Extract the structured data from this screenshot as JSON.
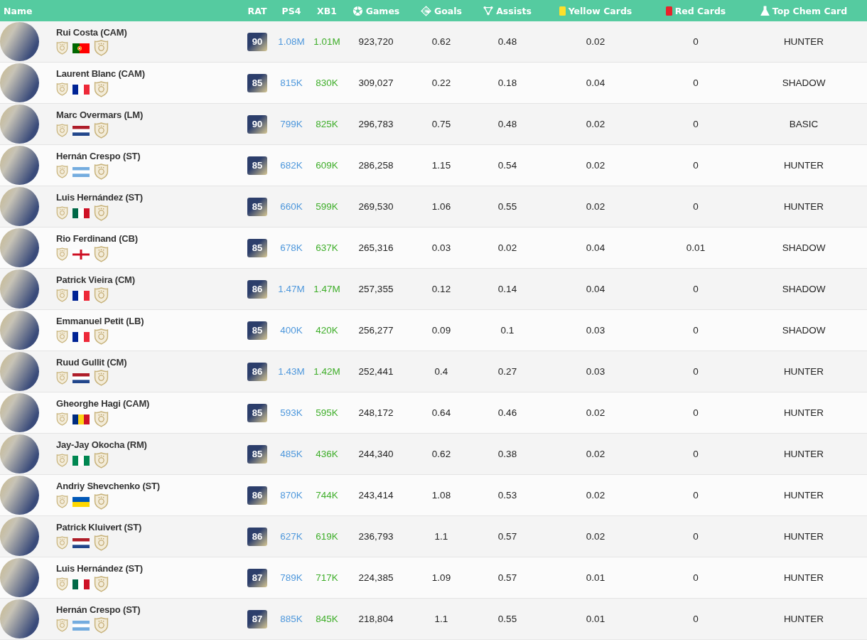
{
  "columns": [
    {
      "label": "Name"
    },
    {
      "label": "RAT"
    },
    {
      "label": "PS4"
    },
    {
      "label": "XB1"
    },
    {
      "label": "Games"
    },
    {
      "label": "Goals"
    },
    {
      "label": "Assists"
    },
    {
      "label": "Yellow Cards"
    },
    {
      "label": "Red Cards"
    },
    {
      "label": "Top Chem Card"
    }
  ],
  "rows": [
    {
      "name": "Rui Costa (CAM)",
      "kind": "portugal",
      "rating": "90",
      "ps4": "1.08M",
      "xb1": "1.01M",
      "games": "923,720",
      "goals": "0.62",
      "assists": "0.48",
      "yellow": "0.02",
      "red": "0",
      "chem": "HUNTER"
    },
    {
      "name": "Laurent Blanc (CAM)",
      "kind": "france",
      "rating": "85",
      "ps4": "815K",
      "xb1": "830K",
      "games": "309,027",
      "goals": "0.22",
      "assists": "0.18",
      "yellow": "0.04",
      "red": "0",
      "chem": "SHADOW"
    },
    {
      "name": "Marc Overmars (LM)",
      "kind": "netherlands",
      "rating": "90",
      "ps4": "799K",
      "xb1": "825K",
      "games": "296,783",
      "goals": "0.75",
      "assists": "0.48",
      "yellow": "0.02",
      "red": "0",
      "chem": "BASIC"
    },
    {
      "name": "Hernán Crespo (ST)",
      "kind": "argentina",
      "rating": "85",
      "ps4": "682K",
      "xb1": "609K",
      "games": "286,258",
      "goals": "1.15",
      "assists": "0.54",
      "yellow": "0.02",
      "red": "0",
      "chem": "HUNTER"
    },
    {
      "name": "Luis Hernández (ST)",
      "kind": "mexico",
      "rating": "85",
      "ps4": "660K",
      "xb1": "599K",
      "games": "269,530",
      "goals": "1.06",
      "assists": "0.55",
      "yellow": "0.02",
      "red": "0",
      "chem": "HUNTER"
    },
    {
      "name": "Rio Ferdinand (CB)",
      "kind": "england",
      "rating": "85",
      "ps4": "678K",
      "xb1": "637K",
      "games": "265,316",
      "goals": "0.03",
      "assists": "0.02",
      "yellow": "0.04",
      "red": "0.01",
      "chem": "SHADOW"
    },
    {
      "name": "Patrick Vieira (CM)",
      "kind": "france",
      "rating": "86",
      "ps4": "1.47M",
      "xb1": "1.47M",
      "games": "257,355",
      "goals": "0.12",
      "assists": "0.14",
      "yellow": "0.04",
      "red": "0",
      "chem": "SHADOW"
    },
    {
      "name": "Emmanuel Petit (LB)",
      "kind": "france",
      "rating": "85",
      "ps4": "400K",
      "xb1": "420K",
      "games": "256,277",
      "goals": "0.09",
      "assists": "0.1",
      "yellow": "0.03",
      "red": "0",
      "chem": "SHADOW"
    },
    {
      "name": "Ruud Gullit (CM)",
      "kind": "netherlands",
      "rating": "86",
      "ps4": "1.43M",
      "xb1": "1.42M",
      "games": "252,441",
      "goals": "0.4",
      "assists": "0.27",
      "yellow": "0.03",
      "red": "0",
      "chem": "HUNTER"
    },
    {
      "name": "Gheorghe Hagi (CAM)",
      "kind": "romania",
      "rating": "85",
      "ps4": "593K",
      "xb1": "595K",
      "games": "248,172",
      "goals": "0.64",
      "assists": "0.46",
      "yellow": "0.02",
      "red": "0",
      "chem": "HUNTER"
    },
    {
      "name": "Jay-Jay Okocha (RM)",
      "kind": "nigeria",
      "rating": "85",
      "ps4": "485K",
      "xb1": "436K",
      "games": "244,340",
      "goals": "0.62",
      "assists": "0.38",
      "yellow": "0.02",
      "red": "0",
      "chem": "HUNTER"
    },
    {
      "name": "Andriy Shevchenko (ST)",
      "kind": "ukraine",
      "rating": "86",
      "ps4": "870K",
      "xb1": "744K",
      "games": "243,414",
      "goals": "1.08",
      "assists": "0.53",
      "yellow": "0.02",
      "red": "0",
      "chem": "HUNTER"
    },
    {
      "name": "Patrick Kluivert (ST)",
      "kind": "netherlands",
      "rating": "86",
      "ps4": "627K",
      "xb1": "619K",
      "games": "236,793",
      "goals": "1.1",
      "assists": "0.57",
      "yellow": "0.02",
      "red": "0",
      "chem": "HUNTER"
    },
    {
      "name": "Luis Hernández (ST)",
      "kind": "mexico",
      "rating": "87",
      "ps4": "789K",
      "xb1": "717K",
      "games": "224,385",
      "goals": "1.09",
      "assists": "0.57",
      "yellow": "0.01",
      "red": "0",
      "chem": "HUNTER"
    },
    {
      "name": "Hernán Crespo (ST)",
      "kind": "argentina",
      "rating": "87",
      "ps4": "885K",
      "xb1": "845K",
      "games": "218,804",
      "goals": "1.1",
      "assists": "0.55",
      "yellow": "0.01",
      "red": "0",
      "chem": "HUNTER"
    }
  ]
}
